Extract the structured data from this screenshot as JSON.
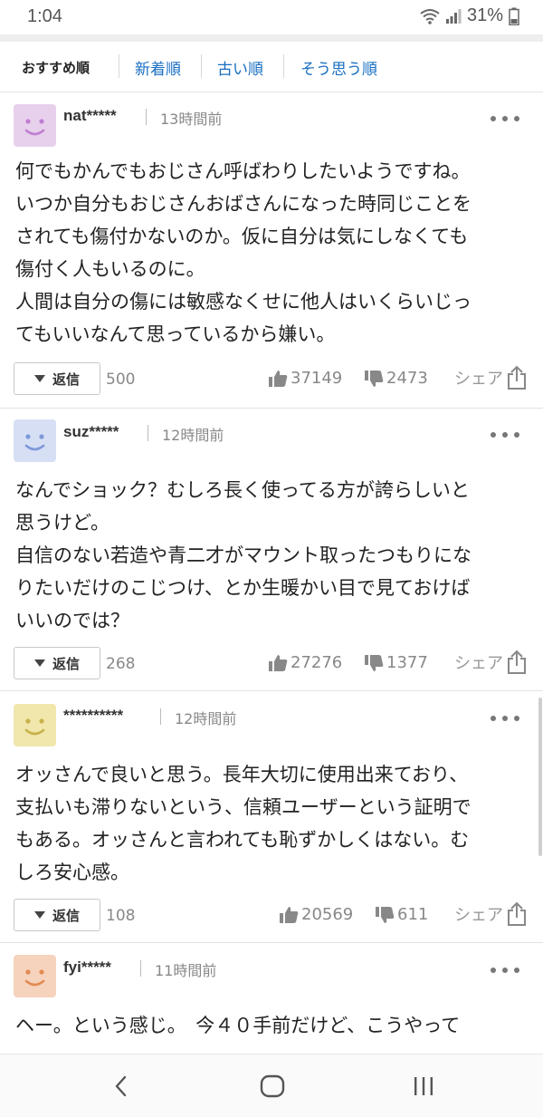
{
  "status_bar": {
    "time": "1:04",
    "battery": "31%"
  },
  "sort_tabs": [
    {
      "label": "おすすめ順",
      "active": true
    },
    {
      "label": "新着順",
      "active": false
    },
    {
      "label": "古い順",
      "active": false
    },
    {
      "label": "そう思う順",
      "active": false
    }
  ],
  "comments": [
    {
      "username": "nat*****",
      "time": "13時間前",
      "avatar_color": "#e7d0ec",
      "avatar_face_color": "#c07fd1",
      "body": "何でもかんでもおじさん呼ばわりしたいようですね。\nいつか自分もおじさんおばさんになった時同じことを\nされても傷付かないのか。仮に自分は気にしなくても\n傷付く人もいるのに。\n人間は自分の傷には敏感なくせに他人はいくらいじっ\nてもいいなんて思っているから嫌い。",
      "reply_label": "返信",
      "reply_count": "500",
      "likes": "37149",
      "dislikes": "2473",
      "share_label": "シェア"
    },
    {
      "username": "suz*****",
      "time": "12時間前",
      "avatar_color": "#d6dff4",
      "avatar_face_color": "#7e99d8",
      "body": "なんでショック？むしろ長く使ってる方が誇らしいと\n思うけど。\n自信のない若造や青二才がマウント取ったつもりにな\nりたいだけのこじつけ、とか生暖かい目で見ておけば\nいいのでは？",
      "reply_label": "返信",
      "reply_count": "268",
      "likes": "27276",
      "dislikes": "1377",
      "share_label": "シェア"
    },
    {
      "username": "**********",
      "time": "12時間前",
      "avatar_color": "#f1e7ad",
      "avatar_face_color": "#c8b24a",
      "body": "オッさんで良いと思う。長年大切に使用出来ており、\n支払いも滞りないという、信頼ユーザーという証明で\nもある。オッさんと言われても恥ずかしくはない。む\nしろ安心感。",
      "reply_label": "返信",
      "reply_count": "108",
      "likes": "20569",
      "dislikes": "611",
      "share_label": "シェア"
    },
    {
      "username": "fyi*****",
      "time": "11時間前",
      "avatar_color": "#f6d3bd",
      "avatar_face_color": "#e28a52",
      "body": "ヘー。という感じ。　今４０手前だけど、こうやって"
    }
  ],
  "bottom_nav": {
    "back_icon": "chevron-left",
    "home_icon": "rounded-square",
    "recents_icon": "three-bars"
  }
}
